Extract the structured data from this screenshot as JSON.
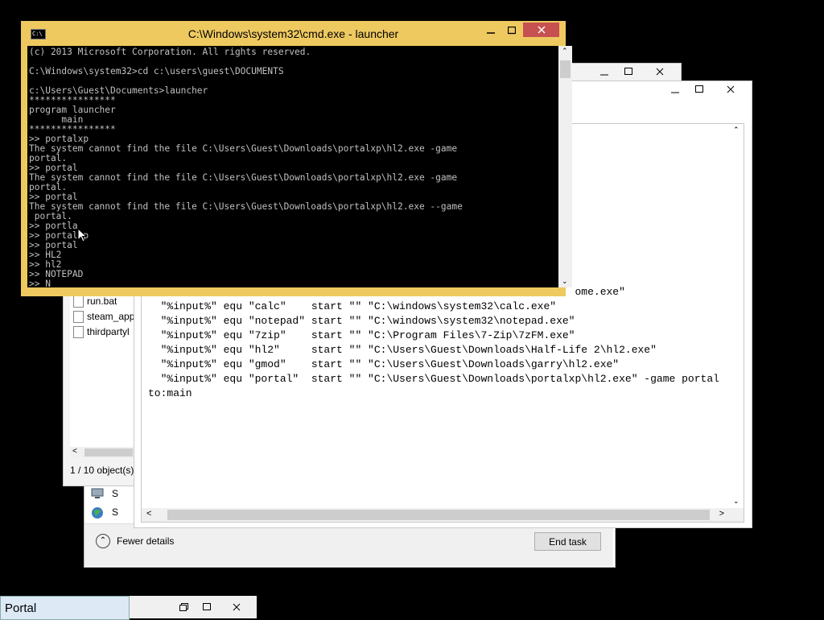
{
  "cmd": {
    "title": "C:\\Windows\\system32\\cmd.exe - launcher",
    "icon_label": "C:\\",
    "lines": [
      "(c) 2013 Microsoft Corporation. All rights reserved.",
      "",
      "C:\\Windows\\system32>cd c:\\users\\guest\\DOCUMENTS",
      "",
      "c:\\Users\\Guest\\Documents>launcher",
      "****************",
      "program launcher",
      "      main",
      "****************",
      ">> portalxp",
      "The system cannot find the file C:\\Users\\Guest\\Downloads\\portalxp\\hl2.exe -game",
      "portal.",
      ">> portal",
      "The system cannot find the file C:\\Users\\Guest\\Downloads\\portalxp\\hl2.exe -game",
      "portal.",
      ">> portal",
      "The system cannot find the file C:\\Users\\Guest\\Downloads\\portalxp\\hl2.exe --game",
      " portal.",
      ">> portla",
      ">> portalxp",
      ">> portal",
      ">> HL2",
      ">> hl2",
      ">> NOTEPAD",
      ">> N_"
    ]
  },
  "notepad": {
    "lines": [
      "                                                                    ome.exe\"",
      "  \"%input%\" equ \"calc\"    start \"\" \"C:\\windows\\system32\\calc.exe\"",
      "  \"%input%\" equ \"notepad\" start \"\" \"C:\\windows\\system32\\notepad.exe\"",
      "  \"%input%\" equ \"7zip\"    start \"\" \"C:\\Program Files\\7-Zip\\7zFM.exe\"",
      "  \"%input%\" equ \"hl2\"     start \"\" \"C:\\Users\\Guest\\Downloads\\Half-Life 2\\hl2.exe\"",
      "  \"%input%\" equ \"gmod\"    start \"\" \"C:\\Users\\Guest\\Downloads\\garry\\hl2.exe\"",
      "  \"%input%\" equ \"portal\"  start \"\" \"C:\\Users\\Guest\\Downloads\\portalxp\\hl2.exe\" -game portal",
      "to:main"
    ]
  },
  "explorer": {
    "files": [
      "run.bat",
      "steam_app",
      "thirdpartyl"
    ],
    "status": "1 / 10 object(s)"
  },
  "taskmgr": {
    "fewer_details": "Fewer details",
    "end_task": "End task",
    "row_labels": [
      "S",
      "S"
    ]
  },
  "taskbar": {
    "portal_title": "Portal"
  },
  "window_controls": {
    "minimize": "▭",
    "maximize": "□",
    "close": "✕"
  },
  "colors": {
    "cmd_frame": "#eec960",
    "close_red": "#c75050",
    "console_bg": "#000000",
    "console_fg": "#c0c0c0"
  }
}
